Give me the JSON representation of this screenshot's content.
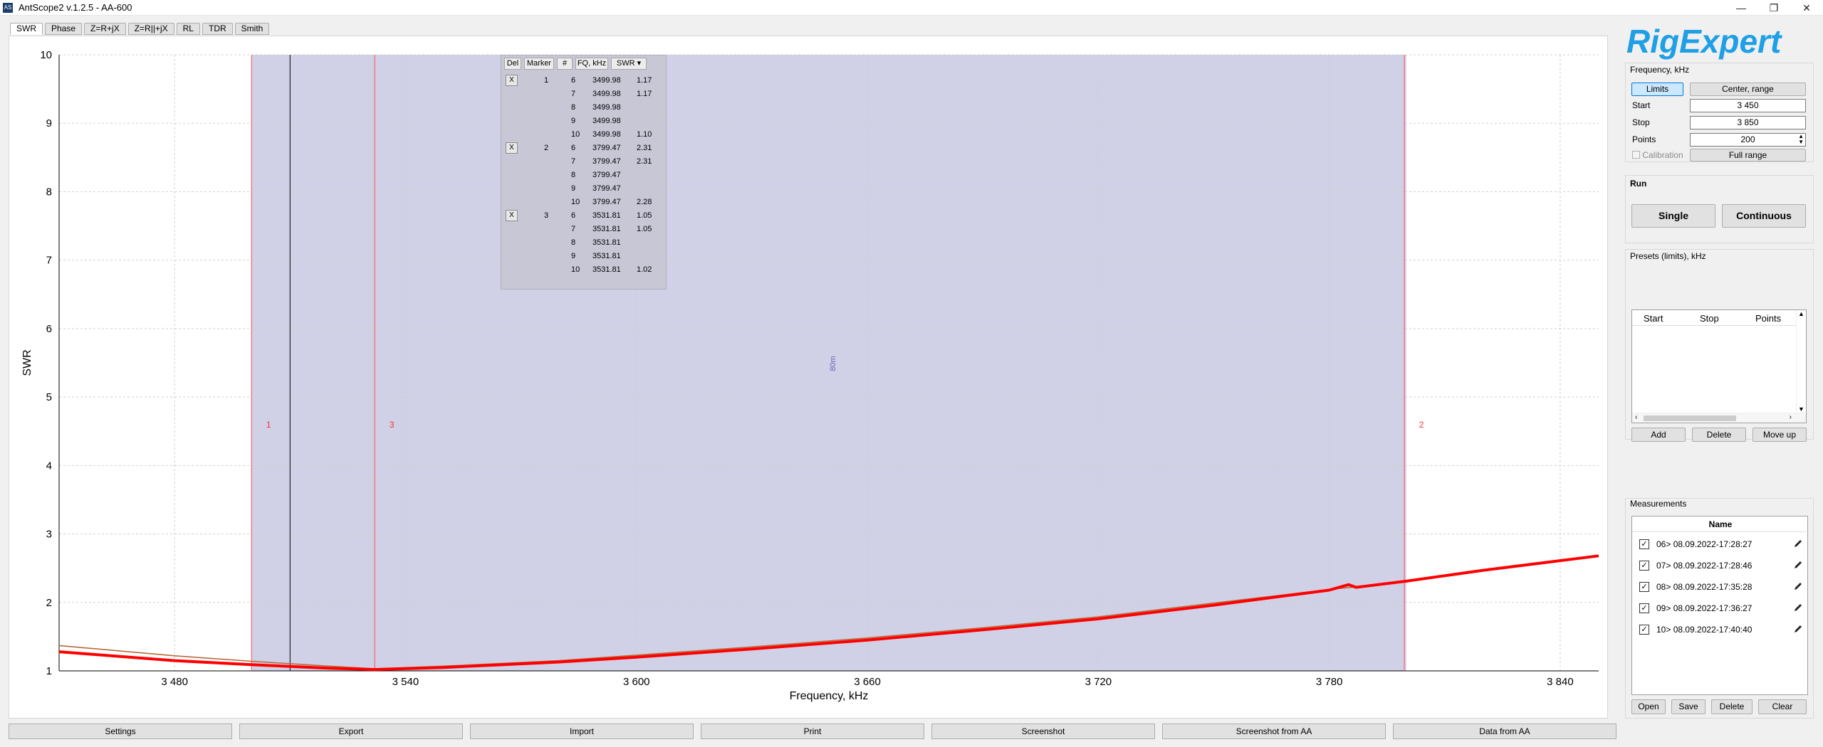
{
  "window": {
    "title": "AntScope2 v.1.2.5 - AA-600",
    "app_icon_text": "AS",
    "controls": [
      "—",
      "❐",
      "✕"
    ]
  },
  "tabs": [
    "SWR",
    "Phase",
    "Z=R+jX",
    "Z=R||+jX",
    "RL",
    "TDR",
    "Smith"
  ],
  "marker_table": {
    "headers": [
      "Del",
      "Marker",
      "#",
      "FQ, kHz",
      "SWR"
    ],
    "rows": [
      {
        "del": "X",
        "marker": "1",
        "n": "6",
        "fq": "3499.98",
        "swr": "1.17"
      },
      {
        "del": "",
        "marker": "",
        "n": "7",
        "fq": "3499.98",
        "swr": "1.17"
      },
      {
        "del": "",
        "marker": "",
        "n": "8",
        "fq": "3499.98",
        "swr": ""
      },
      {
        "del": "",
        "marker": "",
        "n": "9",
        "fq": "3499.98",
        "swr": ""
      },
      {
        "del": "",
        "marker": "",
        "n": "10",
        "fq": "3499.98",
        "swr": "1.10"
      },
      {
        "del": "X",
        "marker": "2",
        "n": "6",
        "fq": "3799.47",
        "swr": "2.31"
      },
      {
        "del": "",
        "marker": "",
        "n": "7",
        "fq": "3799.47",
        "swr": "2.31"
      },
      {
        "del": "",
        "marker": "",
        "n": "8",
        "fq": "3799.47",
        "swr": ""
      },
      {
        "del": "",
        "marker": "",
        "n": "9",
        "fq": "3799.47",
        "swr": ""
      },
      {
        "del": "",
        "marker": "",
        "n": "10",
        "fq": "3799.47",
        "swr": "2.28"
      },
      {
        "del": "X",
        "marker": "3",
        "n": "6",
        "fq": "3531.81",
        "swr": "1.05"
      },
      {
        "del": "",
        "marker": "",
        "n": "7",
        "fq": "3531.81",
        "swr": "1.05"
      },
      {
        "del": "",
        "marker": "",
        "n": "8",
        "fq": "3531.81",
        "swr": ""
      },
      {
        "del": "",
        "marker": "",
        "n": "9",
        "fq": "3531.81",
        "swr": ""
      },
      {
        "del": "",
        "marker": "",
        "n": "10",
        "fq": "3531.81",
        "swr": "1.02"
      }
    ]
  },
  "chart_data": {
    "type": "line",
    "xlabel": "Frequency, kHz",
    "ylabel": "SWR",
    "xlim": [
      3450,
      3850
    ],
    "ylim": [
      1,
      10
    ],
    "x_ticks": [
      "3 480",
      "3 540",
      "3 600",
      "3 660",
      "3 720",
      "3 780",
      "3 840"
    ],
    "x_tick_values": [
      3480,
      3540,
      3600,
      3660,
      3720,
      3780,
      3840
    ],
    "y_ticks": [
      "1",
      "2",
      "3",
      "4",
      "5",
      "6",
      "7",
      "8",
      "9",
      "10"
    ],
    "band": {
      "label": "80m",
      "from": 3500,
      "to": 3800,
      "color": "#c8c8e2"
    },
    "markers": [
      {
        "label": "1",
        "x": 3500
      },
      {
        "label": "3",
        "x": 3532
      },
      {
        "label": "2",
        "x": 3799.5
      }
    ],
    "cursor_x": 3510,
    "series": [
      {
        "color": "#ff0000",
        "x": [
          3450,
          3480,
          3500,
          3520,
          3532,
          3550,
          3580,
          3600,
          3630,
          3660,
          3690,
          3720,
          3750,
          3780,
          3785,
          3787,
          3800,
          3820,
          3850
        ],
        "y": [
          1.28,
          1.15,
          1.09,
          1.04,
          1.02,
          1.05,
          1.13,
          1.2,
          1.32,
          1.45,
          1.6,
          1.76,
          1.96,
          2.18,
          2.26,
          2.22,
          2.31,
          2.47,
          2.68
        ]
      },
      {
        "color": "#b8683a",
        "x": [
          3450,
          3480,
          3500,
          3520,
          3532,
          3550,
          3580,
          3600,
          3630,
          3660,
          3690,
          3720,
          3750,
          3780,
          3800
        ],
        "y": [
          1.37,
          1.22,
          1.14,
          1.07,
          1.03,
          1.07,
          1.15,
          1.23,
          1.35,
          1.48,
          1.63,
          1.79,
          1.99,
          2.19,
          2.3
        ]
      }
    ]
  },
  "logo": {
    "text": "RigExpert"
  },
  "frequency_group": {
    "title": "Frequency, kHz",
    "limits_label": "Limits",
    "center_range_label": "Center, range",
    "start_label": "Start",
    "start_value": "3 450",
    "stop_label": "Stop",
    "stop_value": "3 850",
    "points_label": "Points",
    "points_value": "200",
    "calibration_label": "Calibration",
    "full_range_label": "Full range"
  },
  "run_group": {
    "title": "Run",
    "single_label": "Single",
    "continuous_label": "Continuous"
  },
  "presets_group": {
    "title": "Presets (limits), kHz",
    "columns": [
      "Start",
      "Stop",
      "Points"
    ],
    "add_label": "Add",
    "delete_label": "Delete",
    "move_up_label": "Move up"
  },
  "measurements_group": {
    "title": "Measurements",
    "column": "Name",
    "items": [
      "06> 08.09.2022-17:28:27",
      "07> 08.09.2022-17:28:46",
      "08> 08.09.2022-17:35:28",
      "09> 08.09.2022-17:36:27",
      "10> 08.09.2022-17:40:40"
    ],
    "open_label": "Open",
    "save_label": "Save",
    "delete_label": "Delete",
    "clear_label": "Clear"
  },
  "bottom_buttons": [
    "Settings",
    "Export",
    "Import",
    "Print",
    "Screenshot",
    "Screenshot from AA",
    "Data from AA"
  ]
}
